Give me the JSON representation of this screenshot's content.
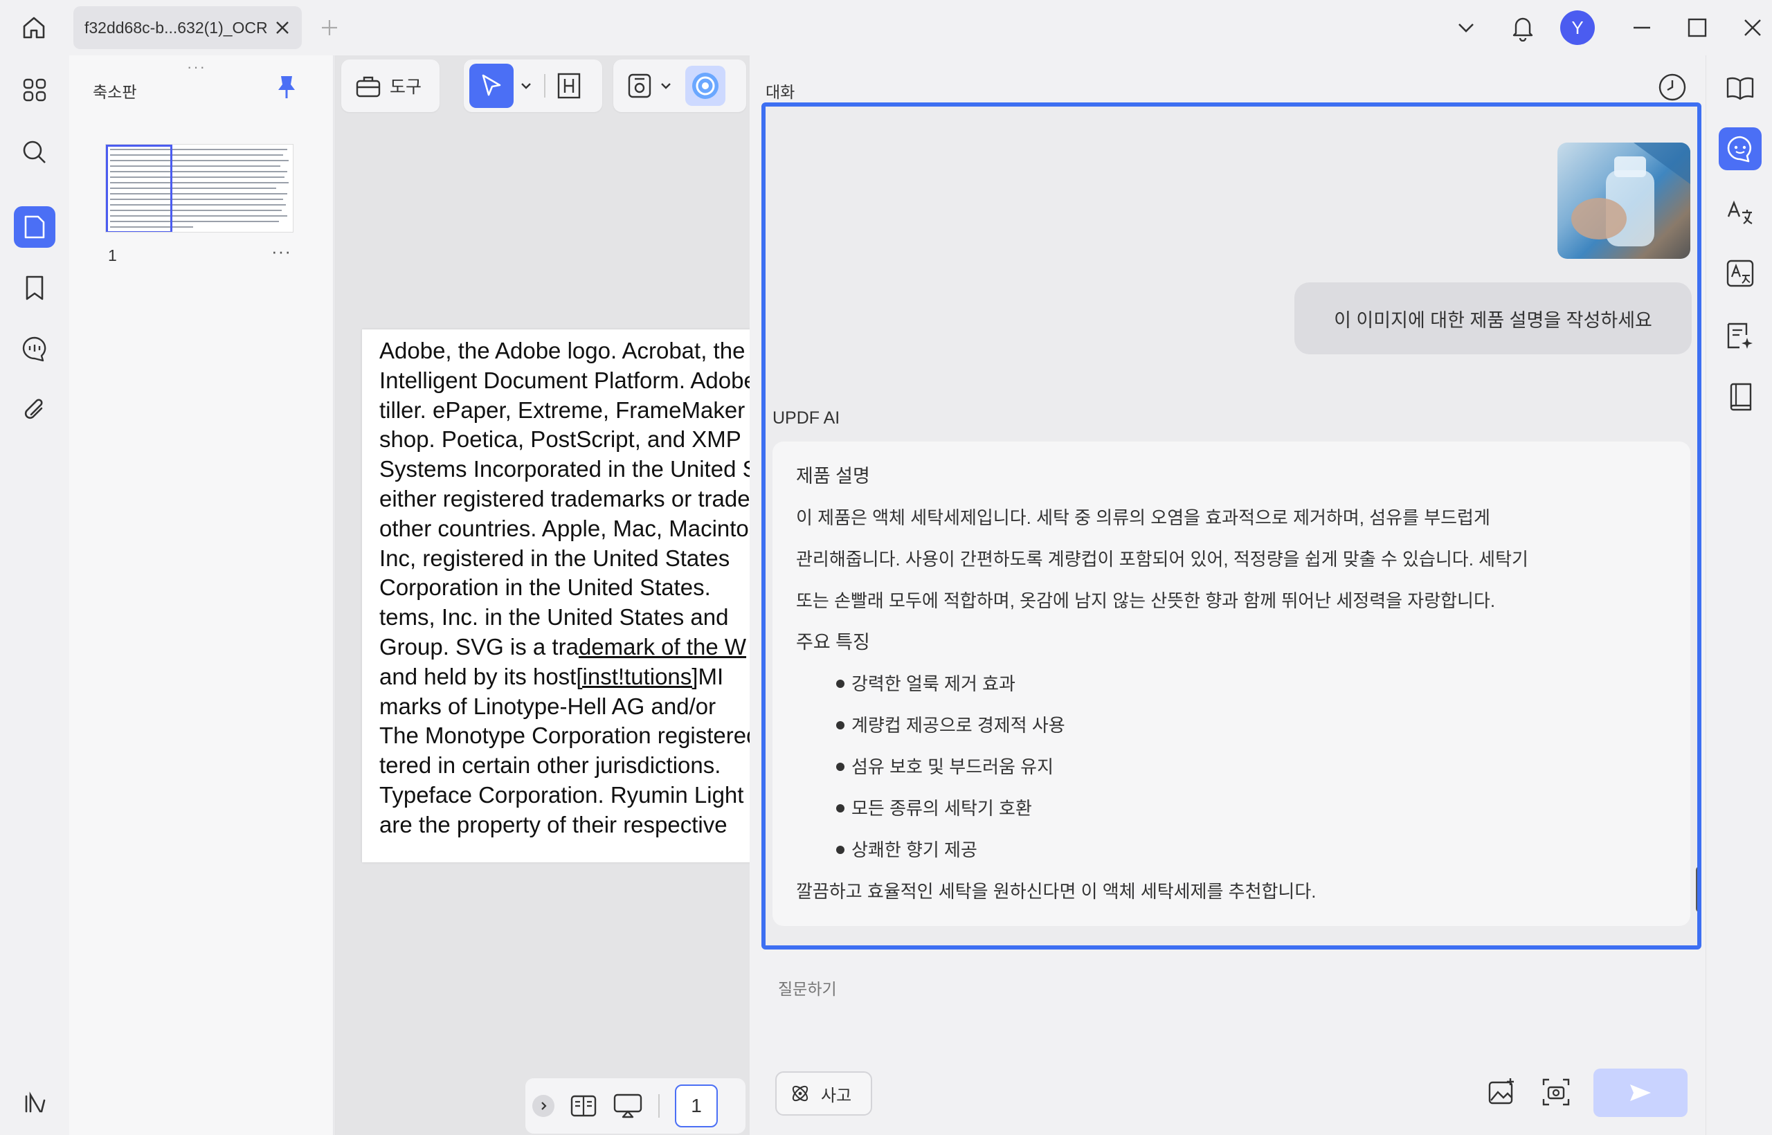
{
  "titlebar": {
    "tab_label": "f32dd68c-b...632(1)_OCR",
    "avatar_letter": "Y"
  },
  "thumbnails": {
    "title": "축소판",
    "page_number": "1",
    "more": "···"
  },
  "toolbar": {
    "tools_label": "도구"
  },
  "document": {
    "lines": [
      "Adobe, the Adobe logo. Acrobat, the Acrobat logo",
      "Intelligent Document Platform. Adobe Reader",
      "tiller. ePaper, Extreme, FrameMaker",
      "shop. Poetica, PostScript, and XMP",
      "Systems Incorporated in the United States",
      "either registered trademarks or trademarks",
      "other countries. Apple, Mac, Macintosh",
      "Inc, registered in the United States",
      "Corporation in the United States.",
      "tems, Inc. in the United States and",
      "Group. SVG is a tra",
      "and held by its host",
      "marks of Linotype-Hell AG and/or",
      "The Monotype Corporation registered",
      "tered in certain other jurisdictions.",
      "Typeface Corporation. Ryumin Light",
      "are the property of their respective"
    ],
    "line11_underlined": "demark of the W",
    "line12_underlined": "[inst!tutions]",
    "line12_tail": "MI"
  },
  "page_nav": {
    "current_page": "1"
  },
  "chat": {
    "title": "대화",
    "user_message": "이 이미지에 대한 제품 설명을 작성하세요",
    "ai_name": "UPDF AI",
    "response": {
      "heading1": "제품 설명",
      "para1_line1": "이 제품은 액체 세탁세제입니다. 세탁 중 의류의 오염을 효과적으로 제거하며, 섬유를 부드럽게",
      "para1_line2": "관리해줍니다. 사용이 간편하도록 계량컵이 포함되어 있어, 적정량을 쉽게 맞출 수 있습니다. 세탁기",
      "para1_line3": "또는 손빨래 모두에 적합하며, 옷감에 남지 않는 산뜻한 향과 함께 뛰어난 세정력을 자랑합니다.",
      "heading2": "주요 특징",
      "features": [
        "강력한 얼룩 제거 효과",
        "계량컵 제공으로 경제적 사용",
        "섬유 보호 및 부드러움 유지",
        "모든 종류의 세탁기 호환",
        "상쾌한 향기 제공"
      ],
      "closing": "깔끔하고 효율적인 세탁을 원하신다면 이 액체 세탁세제를 추천합니다."
    },
    "input_placeholder": "질문하기",
    "think_label": "사고"
  },
  "colors": {
    "accent": "#4b6ff5",
    "chat_border": "#3d6ff2",
    "send_disabled": "#c9d3ff"
  }
}
